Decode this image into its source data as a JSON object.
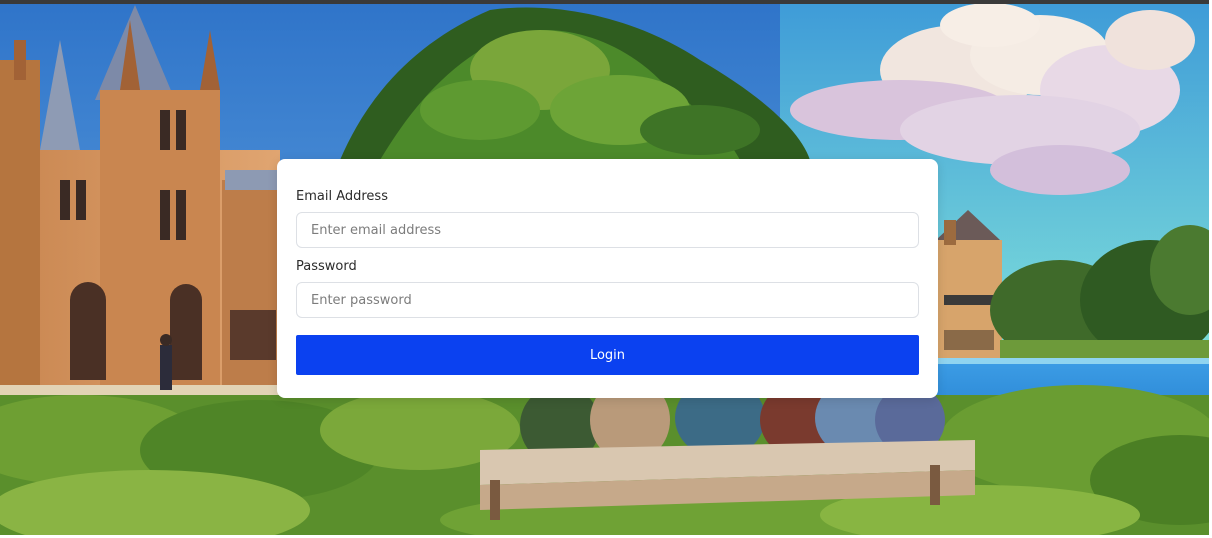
{
  "login": {
    "email_label": "Email Address",
    "email_placeholder": "Enter email address",
    "email_value": "",
    "password_label": "Password",
    "password_placeholder": "Enter password",
    "password_value": "",
    "submit_label": "Login"
  },
  "colors": {
    "primary": "#0b41f0",
    "card_background": "#ffffff"
  }
}
